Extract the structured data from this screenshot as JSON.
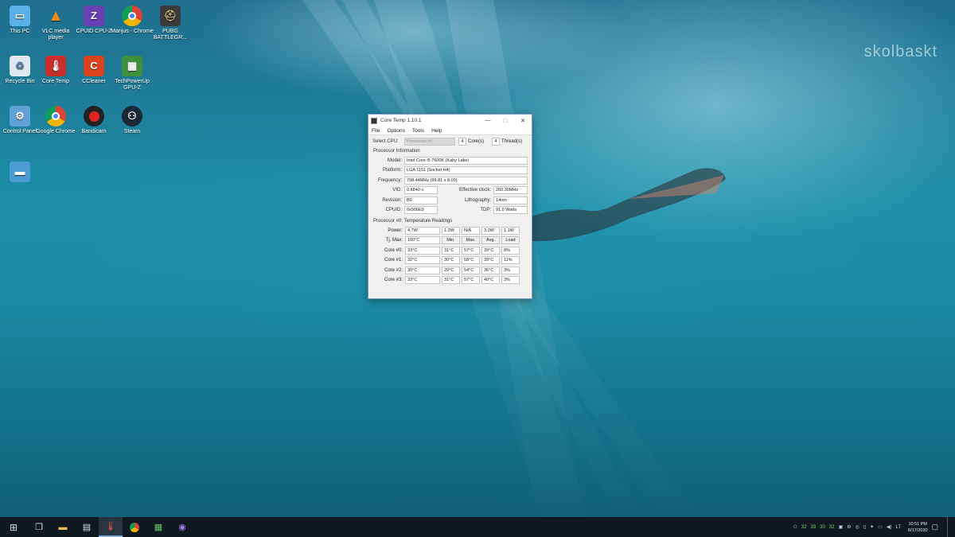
{
  "watermark": "skolbaskt",
  "desktop_icons": [
    {
      "label": "This PC",
      "icon": "this-pc-icon"
    },
    {
      "label": "VLC media player",
      "icon": "vlc-icon"
    },
    {
      "label": "CPUID CPU-Z",
      "icon": "cpu-z-icon"
    },
    {
      "label": "Marijus - Chrome",
      "icon": "chrome-icon"
    },
    {
      "label": "PUBG BATTLEGR...",
      "icon": "pubg-icon"
    },
    {
      "label": "Recycle Bin",
      "icon": "recycle-bin-icon"
    },
    {
      "label": "Core Temp",
      "icon": "core-temp-icon"
    },
    {
      "label": "CCleaner",
      "icon": "ccleaner-icon"
    },
    {
      "label": "TechPowerUp GPU-Z",
      "icon": "gpu-z-icon"
    },
    {
      "label": "Control Panel",
      "icon": "control-panel-icon"
    },
    {
      "label": "Google Chrome",
      "icon": "chrome-icon"
    },
    {
      "label": "Bandicam",
      "icon": "bandicam-icon"
    },
    {
      "label": "Steam",
      "icon": "steam-icon"
    }
  ],
  "window": {
    "title": "Core Temp 1.10.1",
    "menu": [
      "File",
      "Options",
      "Tools",
      "Help"
    ],
    "select_cpu_label": "Select CPU:",
    "select_cpu_value": "Processor #0",
    "cores_value": "4",
    "cores_label": "Core(s)",
    "threads_value": "4",
    "threads_label": "Thread(s)",
    "proc_info_header": "Processor Information",
    "model_label": "Model:",
    "model_value": "Intel Core i5 7600K (Kaby Lake)",
    "platform_label": "Platform:",
    "platform_value": "LGA 1151 (Socket H4)",
    "frequency_label": "Frequency:",
    "frequency_value": "798.44MHz (99.81 x 8.00)",
    "vid_label": "VID:",
    "vid_value": "0.6840 v",
    "eff_clock_label": "Effective clock:",
    "eff_clock_value": "260.30MHz",
    "revision_label": "Revision:",
    "revision_value": "B0",
    "lithography_label": "Lithography:",
    "lithography_value": "14nm",
    "cpuid_label": "CPUID:",
    "cpuid_value": "0x906E9",
    "tdp_label": "TDP:",
    "tdp_value": "91.0 Watts",
    "temp_header": "Processor #0: Temperature Readings",
    "rows": [
      {
        "label": "Power:",
        "cells": [
          "4.7W",
          "1.2W",
          "N/A",
          "3.0W",
          "1.1W"
        ]
      },
      {
        "label": "Tj. Max:",
        "cells": [
          "100°C",
          "Min.",
          "Max.",
          "Avg.",
          "Load"
        ]
      },
      {
        "label": "Core #0:",
        "cells": [
          "33°C",
          "31°C",
          "57°C",
          "39°C",
          "8%"
        ]
      },
      {
        "label": "Core #1:",
        "cells": [
          "32°C",
          "30°C",
          "58°C",
          "39°C",
          "11%"
        ]
      },
      {
        "label": "Core #2:",
        "cells": [
          "30°C",
          "29°C",
          "54°C",
          "36°C",
          "3%"
        ]
      },
      {
        "label": "Core #3:",
        "cells": [
          "33°C",
          "31°C",
          "57°C",
          "40°C",
          "3%"
        ]
      }
    ]
  },
  "taskbar": {
    "apps": [
      "start-icon",
      "task-view-icon",
      "file-explorer-icon",
      "calculator-icon",
      "core-temp-icon",
      "chrome-icon",
      "gpu-z-icon",
      "cpu-z-icon"
    ],
    "tray_temps": [
      "32",
      "33",
      "30",
      "32"
    ],
    "time": "10:51 PM",
    "date": "8/17/2020",
    "lang": "LT"
  }
}
